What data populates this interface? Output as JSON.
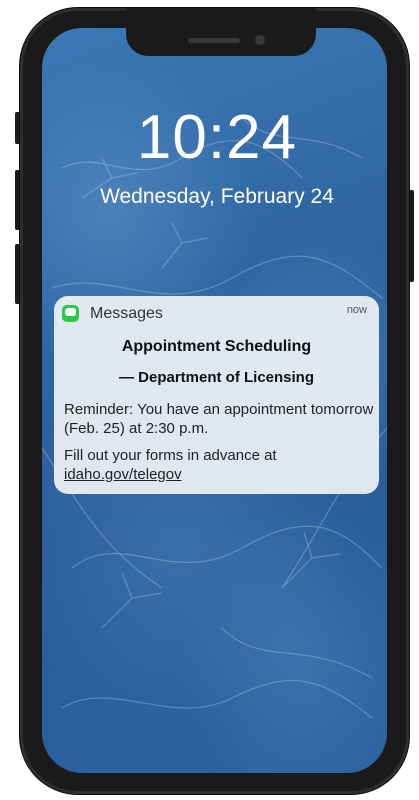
{
  "lock_screen": {
    "time": "10:24",
    "date": "Wednesday, February 24"
  },
  "notification": {
    "app_icon": "messages-icon",
    "app_name": "Messages",
    "timestamp": "now",
    "title": "Appointment Scheduling",
    "subtitle": "— Department of Licensing",
    "body_reminder": "Reminder: You have an appointment tomorrow (Feb. 25) at 2:30 p.m.",
    "body_forms_prefix": "Fill out your forms in advance at",
    "link_text": "idaho.gov/telegov"
  },
  "colors": {
    "wallpaper": "#2f66a3",
    "messages_green": "#2ac94a",
    "phone_frame": "#1a1a1a"
  }
}
